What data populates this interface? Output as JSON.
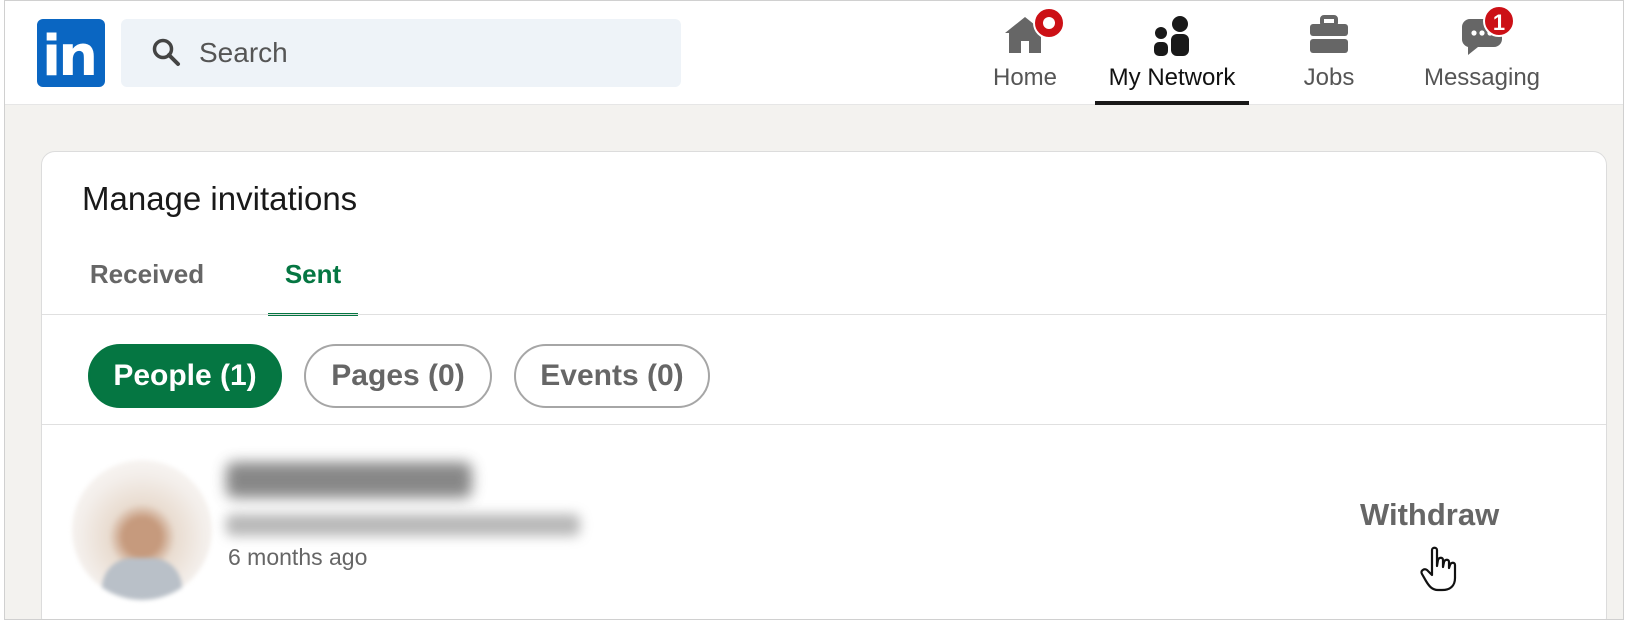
{
  "header": {
    "logo_text": "in",
    "search": {
      "placeholder": "Search",
      "value": ""
    },
    "nav": [
      {
        "label": "Home",
        "icon": "home-icon",
        "badge": ""
      },
      {
        "label": "My Network",
        "icon": "people-icon",
        "active": true
      },
      {
        "label": "Jobs",
        "icon": "briefcase-icon"
      },
      {
        "label": "Messaging",
        "icon": "chat-icon",
        "badge": "1"
      }
    ]
  },
  "invitations": {
    "title": "Manage invitations",
    "tabs": [
      {
        "label": "Received",
        "active": false
      },
      {
        "label": "Sent",
        "active": true
      }
    ],
    "filters": [
      {
        "label": "People (1)",
        "active": true
      },
      {
        "label": "Pages (0)",
        "active": false
      },
      {
        "label": "Events (0)",
        "active": false
      }
    ],
    "items": [
      {
        "time": "6 months ago",
        "action": "Withdraw"
      }
    ]
  },
  "colors": {
    "brand": "#0a66c2",
    "accent_green": "#057642",
    "badge_red": "#cc1016",
    "page_bg": "#f3f2ef"
  }
}
